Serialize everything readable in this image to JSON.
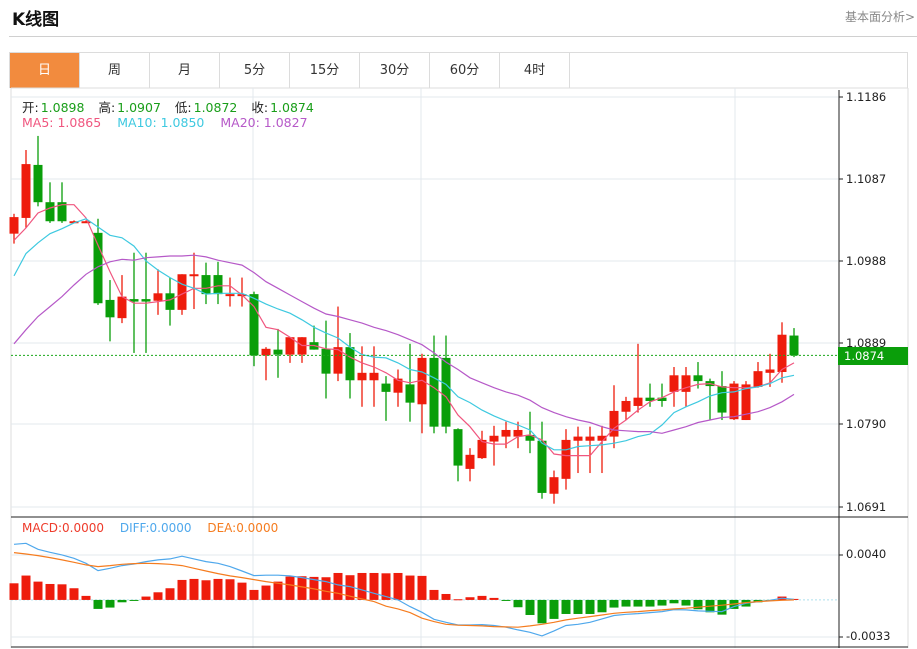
{
  "header": {
    "title": "K线图",
    "fundamental_link": "基本面分析>"
  },
  "tabs": [
    {
      "label": "日",
      "active": true
    },
    {
      "label": "周"
    },
    {
      "label": "月"
    },
    {
      "label": "5分"
    },
    {
      "label": "15分"
    },
    {
      "label": "30分"
    },
    {
      "label": "60分"
    },
    {
      "label": "4时"
    }
  ],
  "ohlc_legend": {
    "open_label": "开:",
    "open": "1.0898",
    "high_label": "高:",
    "high": "1.0907",
    "low_label": "低:",
    "low": "1.0872",
    "close_label": "收:",
    "close": "1.0874"
  },
  "ma_legend": {
    "ma5": "MA5: 1.0865",
    "ma10": "MA10: 1.0850",
    "ma20": "MA20: 1.0827"
  },
  "macd_legend": {
    "macd": "MACD:0.0000",
    "diff": "DIFF:0.0000",
    "dea": "DEA:0.0000"
  },
  "current_price": "1.0874",
  "colors": {
    "up": "#ee1c0c",
    "down": "#0a9e0a",
    "ma5": "#f0567f",
    "ma10": "#3ec9e0",
    "ma20": "#b659c8",
    "diff": "#4fa8ec",
    "dea": "#f57c1f",
    "accent": "#f28b3e"
  },
  "chart_data": {
    "type": "candlestick",
    "price_axis": {
      "ticks": [
        "1.1186",
        "1.1087",
        "1.0988",
        "1.0889",
        "1.0790",
        "1.0691"
      ],
      "range": [
        1.0691,
        1.1186
      ]
    },
    "macd_axis": {
      "ticks": [
        "0.0040",
        "-0.0033"
      ],
      "range": [
        -0.0033,
        0.004
      ]
    },
    "ohlc": [
      [
        1.1021,
        1.1045,
        1.1009,
        1.1041
      ],
      [
        1.104,
        1.1122,
        1.1028,
        1.1105
      ],
      [
        1.1104,
        1.1139,
        1.1054,
        1.1059
      ],
      [
        1.1059,
        1.1083,
        1.1034,
        1.1036
      ],
      [
        1.1059,
        1.1083,
        1.1034,
        1.1036
      ],
      [
        1.1036,
        1.1037,
        1.1035,
        1.1036
      ],
      [
        1.1036,
        1.1037,
        1.1035,
        1.1036
      ],
      [
        1.1022,
        1.1039,
        1.0935,
        1.0937
      ],
      [
        1.0941,
        1.0965,
        1.0891,
        1.092
      ],
      [
        1.0919,
        1.0971,
        1.0913,
        1.0945
      ],
      [
        1.0942,
        1.0998,
        1.0877,
        1.0939
      ],
      [
        1.0942,
        1.0998,
        1.0877,
        1.0939
      ],
      [
        1.094,
        1.0978,
        1.0923,
        1.0949
      ],
      [
        1.0949,
        1.0968,
        1.091,
        1.0929
      ],
      [
        1.0929,
        1.0972,
        1.0923,
        1.0972
      ],
      [
        1.0971,
        1.0998,
        1.093,
        1.0972
      ],
      [
        1.0971,
        1.0986,
        1.0936,
        1.0948
      ],
      [
        1.0971,
        1.0987,
        1.0936,
        1.0948
      ],
      [
        1.0946,
        1.0968,
        1.0933,
        1.0948
      ],
      [
        1.0946,
        1.0968,
        1.0933,
        1.0948
      ],
      [
        1.0948,
        1.0951,
        1.0861,
        1.0874
      ],
      [
        1.0874,
        1.0884,
        1.0844,
        1.0882
      ],
      [
        1.0881,
        1.0906,
        1.0847,
        1.0875
      ],
      [
        1.0875,
        1.0896,
        1.0865,
        1.0896
      ],
      [
        1.0875,
        1.0896,
        1.0865,
        1.0896
      ],
      [
        1.089,
        1.091,
        1.0881,
        1.0881
      ],
      [
        1.0882,
        1.0916,
        1.0822,
        1.0852
      ],
      [
        1.0852,
        1.0933,
        1.0843,
        1.0884
      ],
      [
        1.0884,
        1.0901,
        1.0822,
        1.0844
      ],
      [
        1.0844,
        1.0885,
        1.0812,
        1.0853
      ],
      [
        1.0844,
        1.0885,
        1.0812,
        1.0853
      ],
      [
        1.084,
        1.0849,
        1.0795,
        1.083
      ],
      [
        1.0829,
        1.0857,
        1.0812,
        1.0846
      ],
      [
        1.0839,
        1.0888,
        1.0794,
        1.0817
      ],
      [
        1.0815,
        1.0876,
        1.078,
        1.0871
      ],
      [
        1.0871,
        1.0898,
        1.078,
        1.0788
      ],
      [
        1.0871,
        1.0898,
        1.078,
        1.0788
      ],
      [
        1.0785,
        1.0786,
        1.0722,
        1.0741
      ],
      [
        1.0737,
        1.0762,
        1.0722,
        1.0754
      ],
      [
        1.075,
        1.0783,
        1.0749,
        1.0772
      ],
      [
        1.077,
        1.0789,
        1.0741,
        1.0777
      ],
      [
        1.0776,
        1.0794,
        1.0762,
        1.0784
      ],
      [
        1.0776,
        1.0794,
        1.0762,
        1.0784
      ],
      [
        1.0778,
        1.0806,
        1.0756,
        1.0771
      ],
      [
        1.0771,
        1.0794,
        1.0701,
        1.0708
      ],
      [
        1.0707,
        1.0735,
        1.0695,
        1.0727
      ],
      [
        1.0725,
        1.0785,
        1.0712,
        1.0772
      ],
      [
        1.0771,
        1.0788,
        1.0732,
        1.0776
      ],
      [
        1.0771,
        1.0788,
        1.0732,
        1.0776
      ],
      [
        1.0771,
        1.0789,
        1.0732,
        1.0777
      ],
      [
        1.0776,
        1.0838,
        1.0762,
        1.0807
      ],
      [
        1.0806,
        1.0824,
        1.0796,
        1.0819
      ],
      [
        1.0813,
        1.0888,
        1.0805,
        1.0823
      ],
      [
        1.0823,
        1.084,
        1.0812,
        1.0819
      ],
      [
        1.0823,
        1.084,
        1.0812,
        1.0819
      ],
      [
        1.083,
        1.086,
        1.0812,
        1.085
      ],
      [
        1.083,
        1.086,
        1.0812,
        1.085
      ],
      [
        1.085,
        1.0866,
        1.0834,
        1.0843
      ],
      [
        1.0843,
        1.0846,
        1.0796,
        1.0837
      ],
      [
        1.0837,
        1.0855,
        1.0796,
        1.0805
      ],
      [
        1.0797,
        1.0843,
        1.0796,
        1.084
      ],
      [
        1.0796,
        1.0843,
        1.0796,
        1.0839
      ],
      [
        1.0836,
        1.0866,
        1.0835,
        1.0855
      ],
      [
        1.0853,
        1.0876,
        1.0836,
        1.0857
      ],
      [
        1.0854,
        1.0914,
        1.0841,
        1.0899
      ],
      [
        1.0898,
        1.0907,
        1.0872,
        1.0874
      ]
    ],
    "ma5": [
      1.1013,
      1.1028,
      1.1046,
      1.1052,
      1.1056,
      1.1056,
      1.104,
      1.1007,
      1.0975,
      1.0945,
      1.0937,
      1.0937,
      1.0939,
      1.0941,
      1.0948,
      1.0955,
      1.0955,
      1.0958,
      1.0958,
      1.0947,
      1.0933,
      1.0908,
      1.0905,
      1.0896,
      1.0886,
      1.0886,
      1.0882,
      1.0881,
      1.0872,
      1.0865,
      1.086,
      1.0853,
      1.0844,
      1.0841,
      1.0844,
      1.0835,
      1.0824,
      1.0802,
      1.0788,
      1.077,
      1.0767,
      1.0767,
      1.0776,
      1.0778,
      1.0772,
      1.0755,
      1.0753,
      1.0753,
      1.0753,
      1.077,
      1.0786,
      1.0796,
      1.0808,
      1.0818,
      1.0823,
      1.083,
      1.0835,
      1.0839,
      1.084,
      1.0836,
      1.0835,
      1.0835,
      1.0836,
      1.0841,
      1.0857,
      1.0865
    ],
    "ma10": [
      1.097,
      1.0997,
      1.101,
      1.1021,
      1.1027,
      1.1034,
      1.1039,
      1.1029,
      1.1019,
      1.1016,
      1.1006,
      1.0988,
      1.0977,
      1.0968,
      1.096,
      1.0955,
      1.0948,
      1.0949,
      1.0949,
      1.0949,
      1.0943,
      1.0936,
      1.093,
      1.0925,
      1.0917,
      1.0908,
      1.0901,
      1.0895,
      1.0884,
      1.0875,
      1.0872,
      1.0871,
      1.0865,
      1.0857,
      1.0854,
      1.0847,
      1.0839,
      1.0824,
      1.0817,
      1.0808,
      1.0801,
      1.0795,
      1.079,
      1.0784,
      1.0768,
      1.076,
      1.076,
      1.0764,
      1.0765,
      1.0766,
      1.0768,
      1.0771,
      1.0776,
      1.0779,
      1.079,
      1.0805,
      1.0812,
      1.0818,
      1.0825,
      1.0829,
      1.083,
      1.0834,
      1.0836,
      1.084,
      1.0847,
      1.085
    ],
    "ma20": [
      1.0888,
      1.0905,
      1.0921,
      1.0933,
      1.0945,
      1.0959,
      1.0972,
      1.0981,
      1.0987,
      1.099,
      1.0989,
      1.0992,
      1.0993,
      1.0994,
      1.0994,
      1.0995,
      1.0993,
      1.0989,
      1.0986,
      1.0983,
      1.0974,
      1.0963,
      1.0955,
      1.0947,
      1.0939,
      1.0931,
      1.0924,
      1.0921,
      1.0917,
      1.0913,
      1.0908,
      1.0904,
      1.0899,
      1.0893,
      1.0887,
      1.0877,
      1.0866,
      1.0857,
      1.0847,
      1.0841,
      1.0835,
      1.083,
      1.0826,
      1.082,
      1.0811,
      1.0805,
      1.08,
      1.0796,
      1.0793,
      1.0788,
      1.0784,
      1.0783,
      1.0782,
      1.0782,
      1.078,
      1.0784,
      1.0788,
      1.0793,
      1.0796,
      1.0799,
      1.08,
      1.0803,
      1.0806,
      1.0811,
      1.0818,
      1.0827
    ],
    "macd": [
      0.00148,
      0.00217,
      0.00163,
      0.00142,
      0.00139,
      0.00104,
      0.00036,
      -0.0008,
      -0.00068,
      -0.00021,
      -6e-05,
      0.0003,
      0.00068,
      0.00104,
      0.00178,
      0.00187,
      0.00175,
      0.00187,
      0.00184,
      0.00154,
      0.00089,
      0.00128,
      0.00163,
      0.00208,
      0.00211,
      0.00205,
      0.00202,
      0.0024,
      0.0022,
      0.0024,
      0.0024,
      0.00237,
      0.0024,
      0.00217,
      0.00214,
      0.00089,
      0.00053,
      6e-05,
      0.00024,
      0.00036,
      0.00018,
      -9e-05,
      -0.00065,
      -0.00134,
      -0.00208,
      -0.00169,
      -0.00125,
      -0.00125,
      -0.00125,
      -0.0011,
      -0.00068,
      -0.00059,
      -0.00059,
      -0.00059,
      -0.0005,
      -0.0003,
      -0.0005,
      -0.00083,
      -0.0011,
      -0.00131,
      -0.0008,
      -0.00059,
      -0.00021,
      -6e-05,
      0.0003,
      9e-05
    ],
    "diff": [
      0.00495,
      0.00504,
      0.00451,
      0.00424,
      0.00401,
      0.00371,
      0.00326,
      0.00261,
      0.00282,
      0.00306,
      0.0032,
      0.00341,
      0.00356,
      0.00365,
      0.00389,
      0.00365,
      0.00341,
      0.00326,
      0.00297,
      0.00258,
      0.00217,
      0.0022,
      0.0022,
      0.00214,
      0.00199,
      0.00181,
      0.00163,
      0.00134,
      0.00119,
      0.00089,
      0.00059,
      0.0003,
      0,
      -0.00059,
      -0.0011,
      -0.00172,
      -0.00199,
      -0.00223,
      -0.00223,
      -0.0022,
      -0.00228,
      -0.00243,
      -0.00267,
      -0.00288,
      -0.0032,
      -0.00276,
      -0.00228,
      -0.00217,
      -0.00199,
      -0.00169,
      -0.00139,
      -0.00128,
      -0.00122,
      -0.00113,
      -0.00104,
      -0.00086,
      -0.00089,
      -0.00098,
      -0.00101,
      -0.00104,
      -0.00059,
      -0.0003,
      -0.00015,
      -3e-05,
      0.00015,
      6e-05
    ],
    "dea": [
      0.00421,
      0.00409,
      0.00395,
      0.00377,
      0.00356,
      0.00335,
      0.00312,
      0.00297,
      0.00306,
      0.00317,
      0.00323,
      0.00326,
      0.00323,
      0.00317,
      0.00306,
      0.00282,
      0.00258,
      0.00234,
      0.00214,
      0.00199,
      0.00181,
      0.00163,
      0.00148,
      0.00134,
      0.00116,
      0.00098,
      0.00077,
      0.00059,
      0.00033,
      9e-05,
      -0.00015,
      -0.00056,
      -0.0008,
      -0.00113,
      -0.00163,
      -0.00193,
      -0.00217,
      -0.00225,
      -0.00228,
      -0.00231,
      -0.00237,
      -0.0024,
      -0.00243,
      -0.00231,
      -0.00217,
      -0.00199,
      -0.00178,
      -0.00163,
      -0.00148,
      -0.00134,
      -0.00119,
      -0.0011,
      -0.00104,
      -0.00095,
      -0.00089,
      -0.0008,
      -0.00074,
      -0.00065,
      -0.00056,
      -0.00047,
      -0.00036,
      -0.00024,
      -0.00015,
      -9e-05,
      -3e-05,
      0
    ]
  }
}
